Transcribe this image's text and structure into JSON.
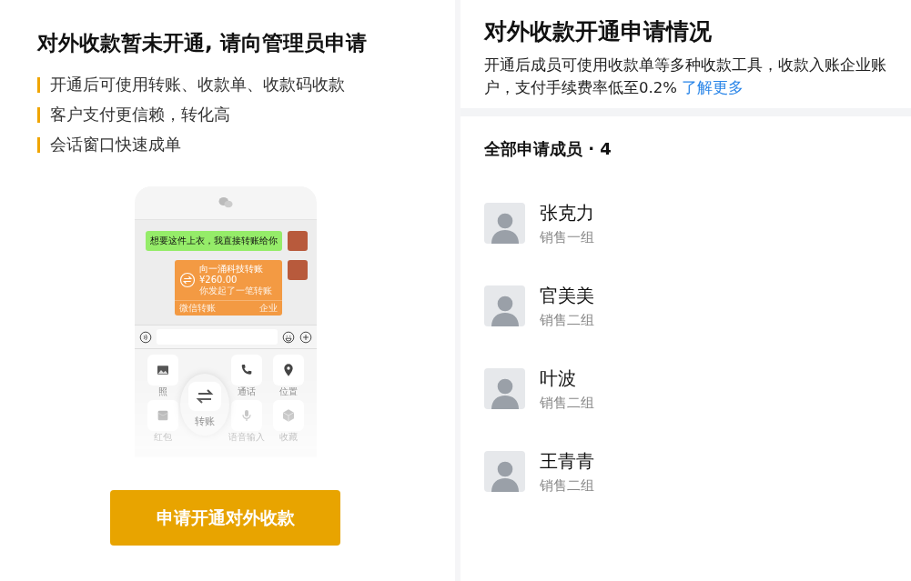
{
  "left": {
    "title": "对外收款暂未开通, 请向管理员申请",
    "features": [
      "开通后可使用转账、收款单、收款码收款",
      "客户支付更信赖，转化高",
      "会话窗口快速成单"
    ],
    "phone": {
      "messages": [
        {
          "kind": "text",
          "text": "想要这件上衣，我直接转账给你"
        },
        {
          "kind": "transfer",
          "title": "向一涌科技转账",
          "amount": "¥260.00",
          "note": "你发起了一笔转账",
          "footer_left": "微信转账",
          "footer_right": "企业"
        }
      ],
      "tools": [
        {
          "kind": "photo",
          "label": "照"
        },
        {
          "kind": "hidden"
        },
        {
          "kind": "phone",
          "label": "通话"
        },
        {
          "kind": "location",
          "label": "位置"
        },
        {
          "kind": "envelope",
          "label": "红包"
        },
        {
          "kind": "hidden"
        },
        {
          "kind": "mic",
          "label": "语音输入"
        },
        {
          "kind": "cube",
          "label": "收藏"
        }
      ],
      "magnifier": {
        "label": "转账"
      }
    },
    "button": "申请开通对外收款"
  },
  "right": {
    "title": "对外收款开通申请情况",
    "description": "开通后成员可使用收款单等多种收款工具，收款入账企业账户，支付手续费率低至0.2%",
    "link": "了解更多",
    "members_heading": "全部申请成员 · 4",
    "members": [
      {
        "name": "张克力",
        "group": "销售一组"
      },
      {
        "name": "官美美",
        "group": "销售二组"
      },
      {
        "name": "叶波",
        "group": "销售二组"
      },
      {
        "name": "王青青",
        "group": "销售二组"
      }
    ]
  }
}
